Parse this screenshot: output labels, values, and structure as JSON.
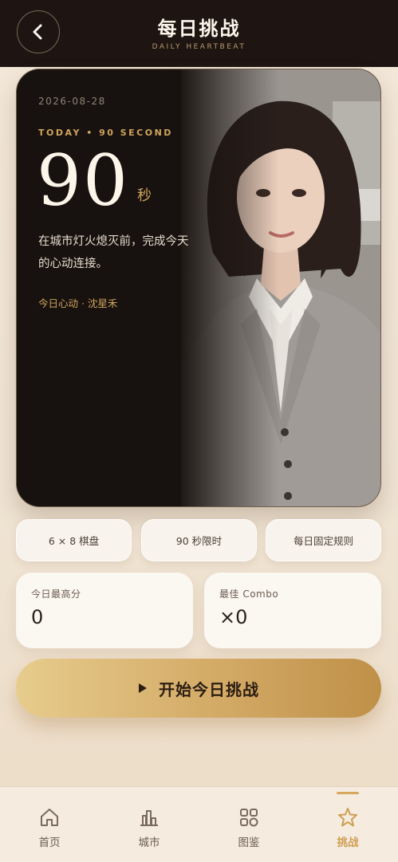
{
  "header": {
    "title": "每日挑战",
    "subtitle": "DAILY HEARTBEAT"
  },
  "hero": {
    "date": "2026-08-28",
    "tag": "TODAY • 90 SECOND",
    "seconds": "90",
    "unit": "秒",
    "description": "在城市灯火熄灭前，完成今天的心动连接。",
    "signature": "今日心动 · 沈星禾"
  },
  "chips": [
    {
      "label": "6 × 8 棋盘"
    },
    {
      "label": "90 秒限时"
    },
    {
      "label": "每日固定规则"
    }
  ],
  "stats": {
    "best_score": {
      "label": "今日最高分",
      "value": "0"
    },
    "best_combo": {
      "label": "最佳 Combo",
      "value": "×0"
    }
  },
  "start_button": {
    "label": "开始今日挑战"
  },
  "nav": {
    "items": [
      {
        "label": "首页",
        "icon": "home-icon"
      },
      {
        "label": "城市",
        "icon": "city-icon"
      },
      {
        "label": "图鉴",
        "icon": "grid-icon"
      },
      {
        "label": "挑战",
        "icon": "star-icon",
        "active": true
      }
    ]
  },
  "colors": {
    "accent": "#d0a55c",
    "header_bg": "#1e1513",
    "card_bg": "#15100e",
    "button_gradient_start": "#e7cc8d",
    "button_gradient_end": "#bf9048"
  }
}
